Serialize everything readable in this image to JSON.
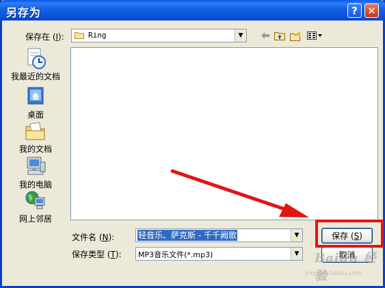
{
  "window": {
    "title": "另存为",
    "help_symbol": "?",
    "close_symbol": "✕"
  },
  "save_in": {
    "label_prefix": "保存在 (",
    "label_key": "I",
    "label_suffix": "):",
    "value": "Ring"
  },
  "toolbar": {
    "icons": [
      "back-arrow-icon",
      "up-folder-icon",
      "new-folder-icon",
      "view-menu-icon"
    ]
  },
  "places": [
    {
      "label": "我最近的文档",
      "icon": "recent-documents-icon"
    },
    {
      "label": "桌面",
      "icon": "desktop-icon"
    },
    {
      "label": "我的文档",
      "icon": "my-documents-icon"
    },
    {
      "label": "我的电脑",
      "icon": "my-computer-icon"
    },
    {
      "label": "网上邻居",
      "icon": "network-places-icon"
    }
  ],
  "filename": {
    "label_prefix": "文件名 (",
    "label_key": "N",
    "label_suffix": "):",
    "value": "轻音乐、萨克斯 - 千千阙歌"
  },
  "filetype": {
    "label_prefix": "保存类型 (",
    "label_key": "T",
    "label_suffix": "):",
    "value": "MP3音乐文件(*.mp3)"
  },
  "buttons": {
    "save_prefix": "保存 (",
    "save_key": "S",
    "save_suffix": ")",
    "cancel": "取消"
  },
  "watermark": {
    "brand": "Baidu 经验",
    "url": "jingyan.baidu.com"
  },
  "colors": {
    "titlebar": "#0A5AE8",
    "selection": "#316AC5",
    "annotation": "#E31414"
  }
}
